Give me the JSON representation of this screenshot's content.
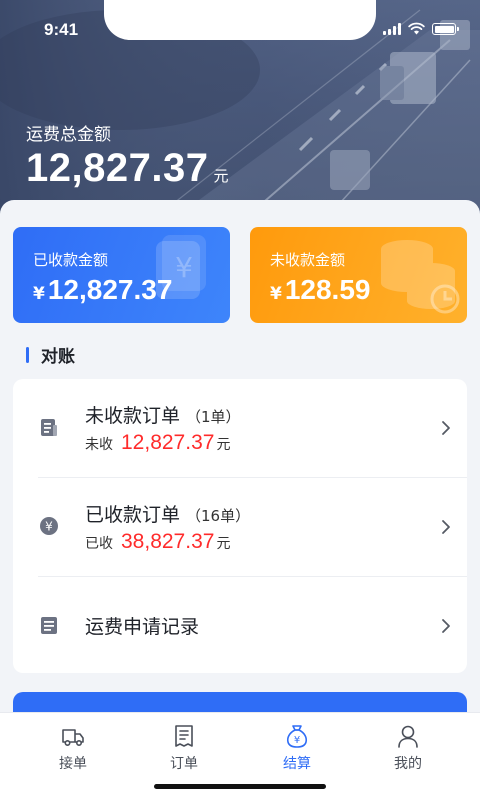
{
  "status_bar": {
    "time": "9:41"
  },
  "hero": {
    "label": "运费总金额",
    "amount": "12,827.37",
    "unit": "元"
  },
  "cards": [
    {
      "title": "已收款金额",
      "currency": "¥",
      "amount": "12,827.37",
      "color": "#2f6df6"
    },
    {
      "title": "未收款金额",
      "currency": "¥",
      "amount": "128.59",
      "color": "#ff9a0c"
    }
  ],
  "section": {
    "title": "对账"
  },
  "list": [
    {
      "title": "未收款订单",
      "count": "（1单）",
      "sub_label": "未收",
      "sub_value": "12,827.37",
      "sub_unit": "元",
      "icon": "document-icon"
    },
    {
      "title": "已收款订单",
      "count": "（16单）",
      "sub_label": "已收",
      "sub_value": "38,827.37",
      "sub_unit": "元",
      "icon": "yen-coin-icon"
    },
    {
      "title": "运费申请记录",
      "icon": "record-icon"
    }
  ],
  "tabs": [
    {
      "label": "接单",
      "icon": "truck-icon",
      "active": false
    },
    {
      "label": "订单",
      "icon": "order-list-icon",
      "active": false
    },
    {
      "label": "结算",
      "icon": "money-bag-icon",
      "active": true
    },
    {
      "label": "我的",
      "icon": "person-icon",
      "active": false
    }
  ],
  "colors": {
    "accent": "#2f6df6",
    "warning": "#ff9a0c",
    "amount_red": "#ff2b2b"
  }
}
